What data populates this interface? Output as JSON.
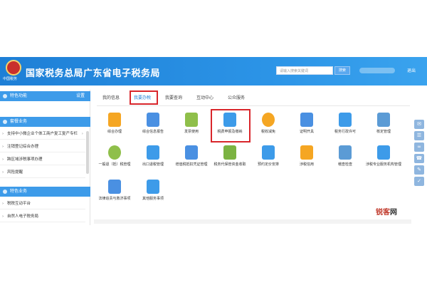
{
  "header": {
    "logo_text": "中国税务",
    "title": "国家税务总局广东省电子税务局",
    "search_placeholder": "请输入搜索关键词",
    "search_button": "搜索",
    "logout": "退出"
  },
  "sidebar": {
    "section1": {
      "title": "特色功能",
      "link": "设置"
    },
    "section2": {
      "title": "套餐业务"
    },
    "items1": [
      "支持中小微企业个体工商户复工复产专栏",
      "注销登记综合办理",
      "跨区域涉税事项办理",
      "风险提醒"
    ],
    "section3": {
      "title": "特色业务"
    },
    "items2": [
      "税税互动平台",
      "自然人电子税务局"
    ]
  },
  "tabs": [
    "我的信息",
    "我要办税",
    "我要查询",
    "互动中心",
    "公众服务"
  ],
  "tiles_row1": [
    "综合办理",
    "综合信息报告",
    "发票使用",
    "税费申报及缴纳",
    "税收减免",
    "证明开具",
    "税务行政许可",
    "核定管理"
  ],
  "tiles_row2": [
    "一般退（抵）税管理",
    "出口退税管理",
    "增值税抵扣凭证管理",
    "税务代保管资金收取",
    "预约定价安排",
    "涉税信用",
    "稽查检查",
    "涉税专业服务机构管理"
  ],
  "tiles_row3": [
    "法律追责与救济事项",
    "其他服务事项"
  ],
  "watermark": {
    "a": "锐客",
    "b": "网"
  },
  "colors": {
    "header": "#1e7fd6",
    "accent": "#3d9be9",
    "highlight": "#d9262b"
  }
}
